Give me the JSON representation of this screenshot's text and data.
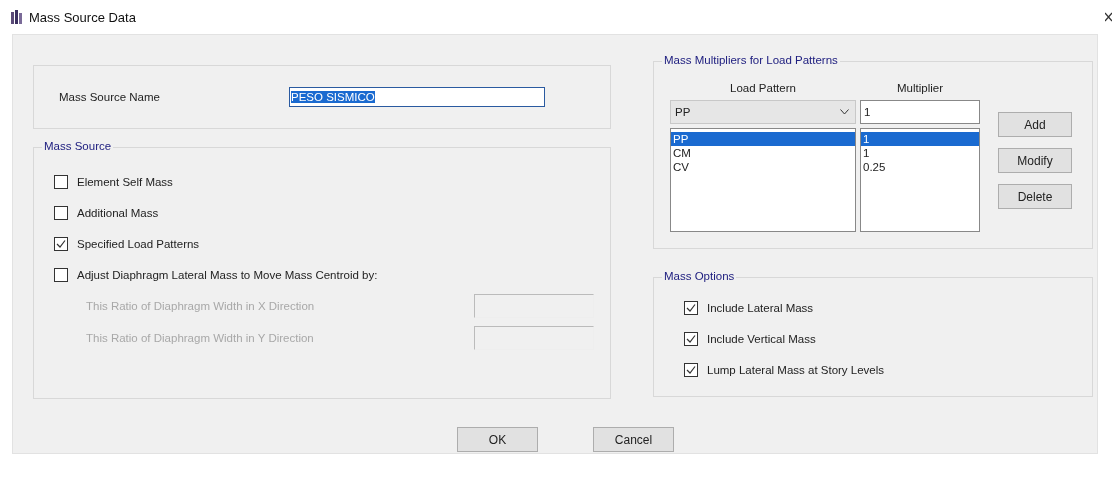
{
  "window": {
    "title": "Mass Source Data"
  },
  "name_group": {
    "label": "Mass Source Name",
    "value": "PESO SISMICO",
    "value_selected": true
  },
  "mass_source": {
    "title": "Mass Source",
    "options": [
      {
        "label": "Element Self Mass",
        "checked": false
      },
      {
        "label": "Additional Mass",
        "checked": false
      },
      {
        "label": "Specified Load Patterns",
        "checked": true
      },
      {
        "label": "Adjust Diaphragm Lateral Mass to Move Mass Centroid by:",
        "checked": false
      }
    ],
    "ratios": [
      {
        "label": "This Ratio of Diaphragm Width in X Direction",
        "disabled": true
      },
      {
        "label": "This Ratio of Diaphragm Width in Y Direction",
        "disabled": true
      }
    ]
  },
  "multipliers": {
    "title": "Mass Multipliers for Load Patterns",
    "columns": [
      "Load Pattern",
      "Multiplier"
    ],
    "pattern_value": "PP",
    "multiplier_value": "1",
    "rows": [
      {
        "load_pattern": "PP",
        "multiplier": "1",
        "selected": true
      },
      {
        "load_pattern": "CM",
        "multiplier": "1",
        "selected": false
      },
      {
        "load_pattern": "CV",
        "multiplier": "0.25",
        "selected": false
      }
    ],
    "buttons": [
      "Add",
      "Modify",
      "Delete"
    ]
  },
  "mass_options": {
    "title": "Mass Options",
    "options": [
      {
        "label": "Include Lateral Mass",
        "checked": true
      },
      {
        "label": "Include Vertical Mass",
        "checked": true
      },
      {
        "label": "Lump Lateral Mass at Story Levels",
        "checked": true
      }
    ]
  },
  "buttons": [
    "OK",
    "Cancel"
  ]
}
